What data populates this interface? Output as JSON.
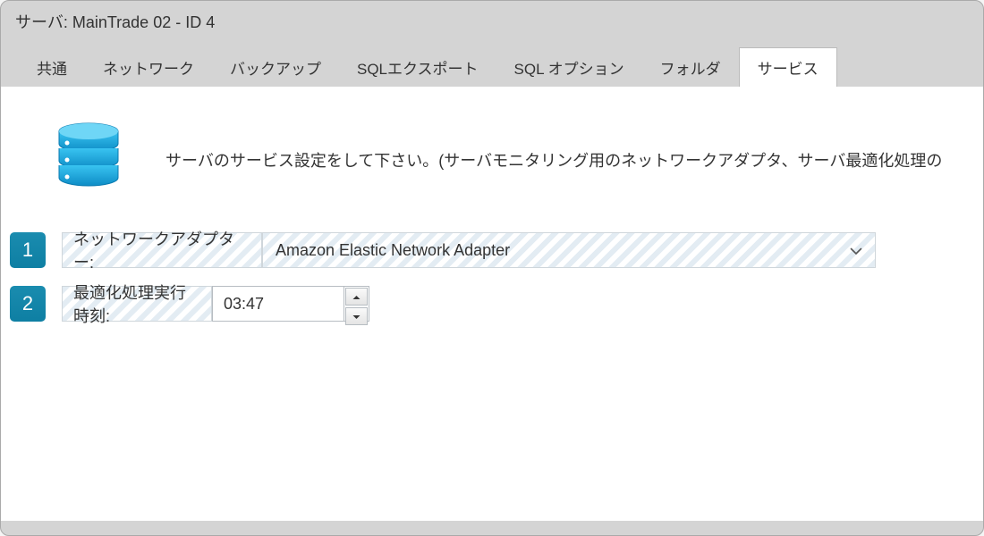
{
  "window": {
    "title": "サーバ: MainTrade 02 - ID  4"
  },
  "tabs": [
    {
      "label": "共通"
    },
    {
      "label": "ネットワーク"
    },
    {
      "label": "バックアップ"
    },
    {
      "label": "SQLエクスポート"
    },
    {
      "label": "SQL オプション"
    },
    {
      "label": "フォルダ"
    },
    {
      "label": "サービス"
    }
  ],
  "panel": {
    "description": "サーバのサービス設定をして下さい。(サーバモニタリング用のネットワークアダプタ、サーバ最適化処理の",
    "steps": [
      {
        "num": "1",
        "label": "ネットワークアダプター:"
      },
      {
        "num": "2",
        "label": "最適化処理実行時刻:"
      }
    ],
    "network_adapter": {
      "value": "Amazon Elastic Network Adapter"
    },
    "optimization_time": {
      "value": "03:47"
    }
  },
  "icons": {
    "server": "server-icon",
    "chevron_down": "chevron-down-icon",
    "spin_up": "spin-up-icon",
    "spin_down": "spin-down-icon"
  },
  "colors": {
    "accent": "#0e7fa3",
    "icon_blue_top": "#2fb4e6",
    "icon_blue_bottom": "#0d8cc5",
    "panel_bg": "#ffffff",
    "window_bg": "#d4d4d4"
  }
}
